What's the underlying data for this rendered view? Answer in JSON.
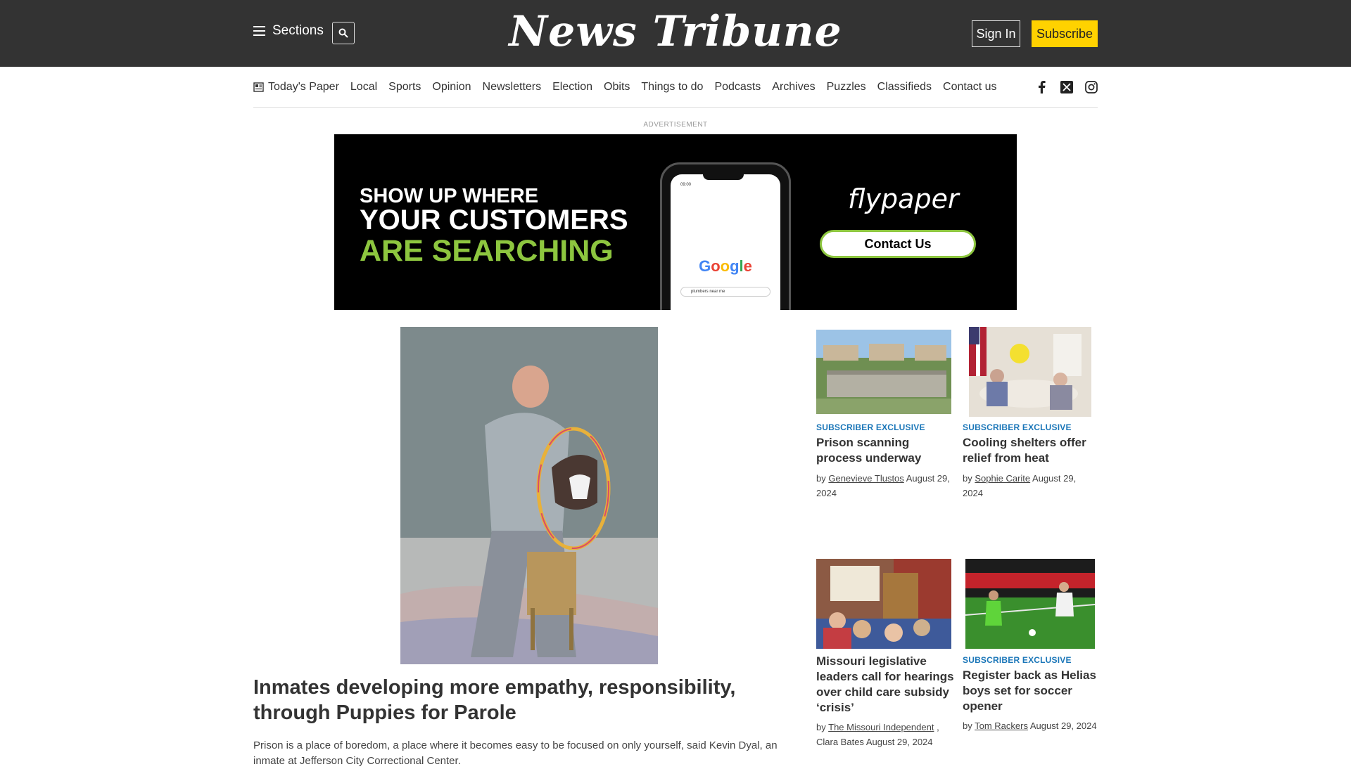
{
  "header": {
    "sections_label": "Sections",
    "logo": "News Tribune",
    "sign_in": "Sign In",
    "subscribe": "Subscribe"
  },
  "nav": {
    "items": [
      "Today's Paper",
      "Local",
      "Sports",
      "Opinion",
      "Newsletters",
      "Election",
      "Obits",
      "Things to do",
      "Podcasts",
      "Archives",
      "Puzzles",
      "Classifieds",
      "Contact us"
    ]
  },
  "ad": {
    "label": "ADVERTISEMENT",
    "line1": "SHOW UP WHERE",
    "line2": "YOUR CUSTOMERS",
    "line3": "ARE SEARCHING",
    "brand": "flypaper",
    "cta": "Contact Us",
    "phone_time": "09:00",
    "google": "Google",
    "search_query": "plumbers near me",
    "accent": "#8dc63f"
  },
  "main_story": {
    "title": "Inmates developing more empathy, responsibility, through Puppies for Parole",
    "summary": "Prison is a place of boredom, a place where it becomes easy to be focused on only yourself, said Kevin Dyal, an inmate at Jefferson City Correctional Center."
  },
  "stories": [
    {
      "tag": "SUBSCRIBER EXCLUSIVE",
      "title": "Prison scanning process underway",
      "by": "by",
      "author": "Genevieve Tlustos",
      "date": "August 29, 2024"
    },
    {
      "tag": "SUBSCRIBER EXCLUSIVE",
      "title": "Cooling shelters offer relief from heat",
      "by": "by",
      "author": "Sophie Carite",
      "date": "August 29, 2024"
    },
    {
      "tag": "",
      "title": "Missouri legislative leaders call for hearings over child care subsidy ‘crisis’",
      "by": "by",
      "author": "The Missouri Independent",
      "coauthor": ", Clara Bates",
      "date": "August 29, 2024"
    },
    {
      "tag": "SUBSCRIBER EXCLUSIVE",
      "title": "Register back as Helias boys set for soccer opener",
      "by": "by",
      "author": "Tom Rackers",
      "date": "August 29, 2024"
    }
  ],
  "colors": {
    "topbar": "#333333",
    "subscribe": "#ffd200",
    "tag": "#1a76b8"
  }
}
